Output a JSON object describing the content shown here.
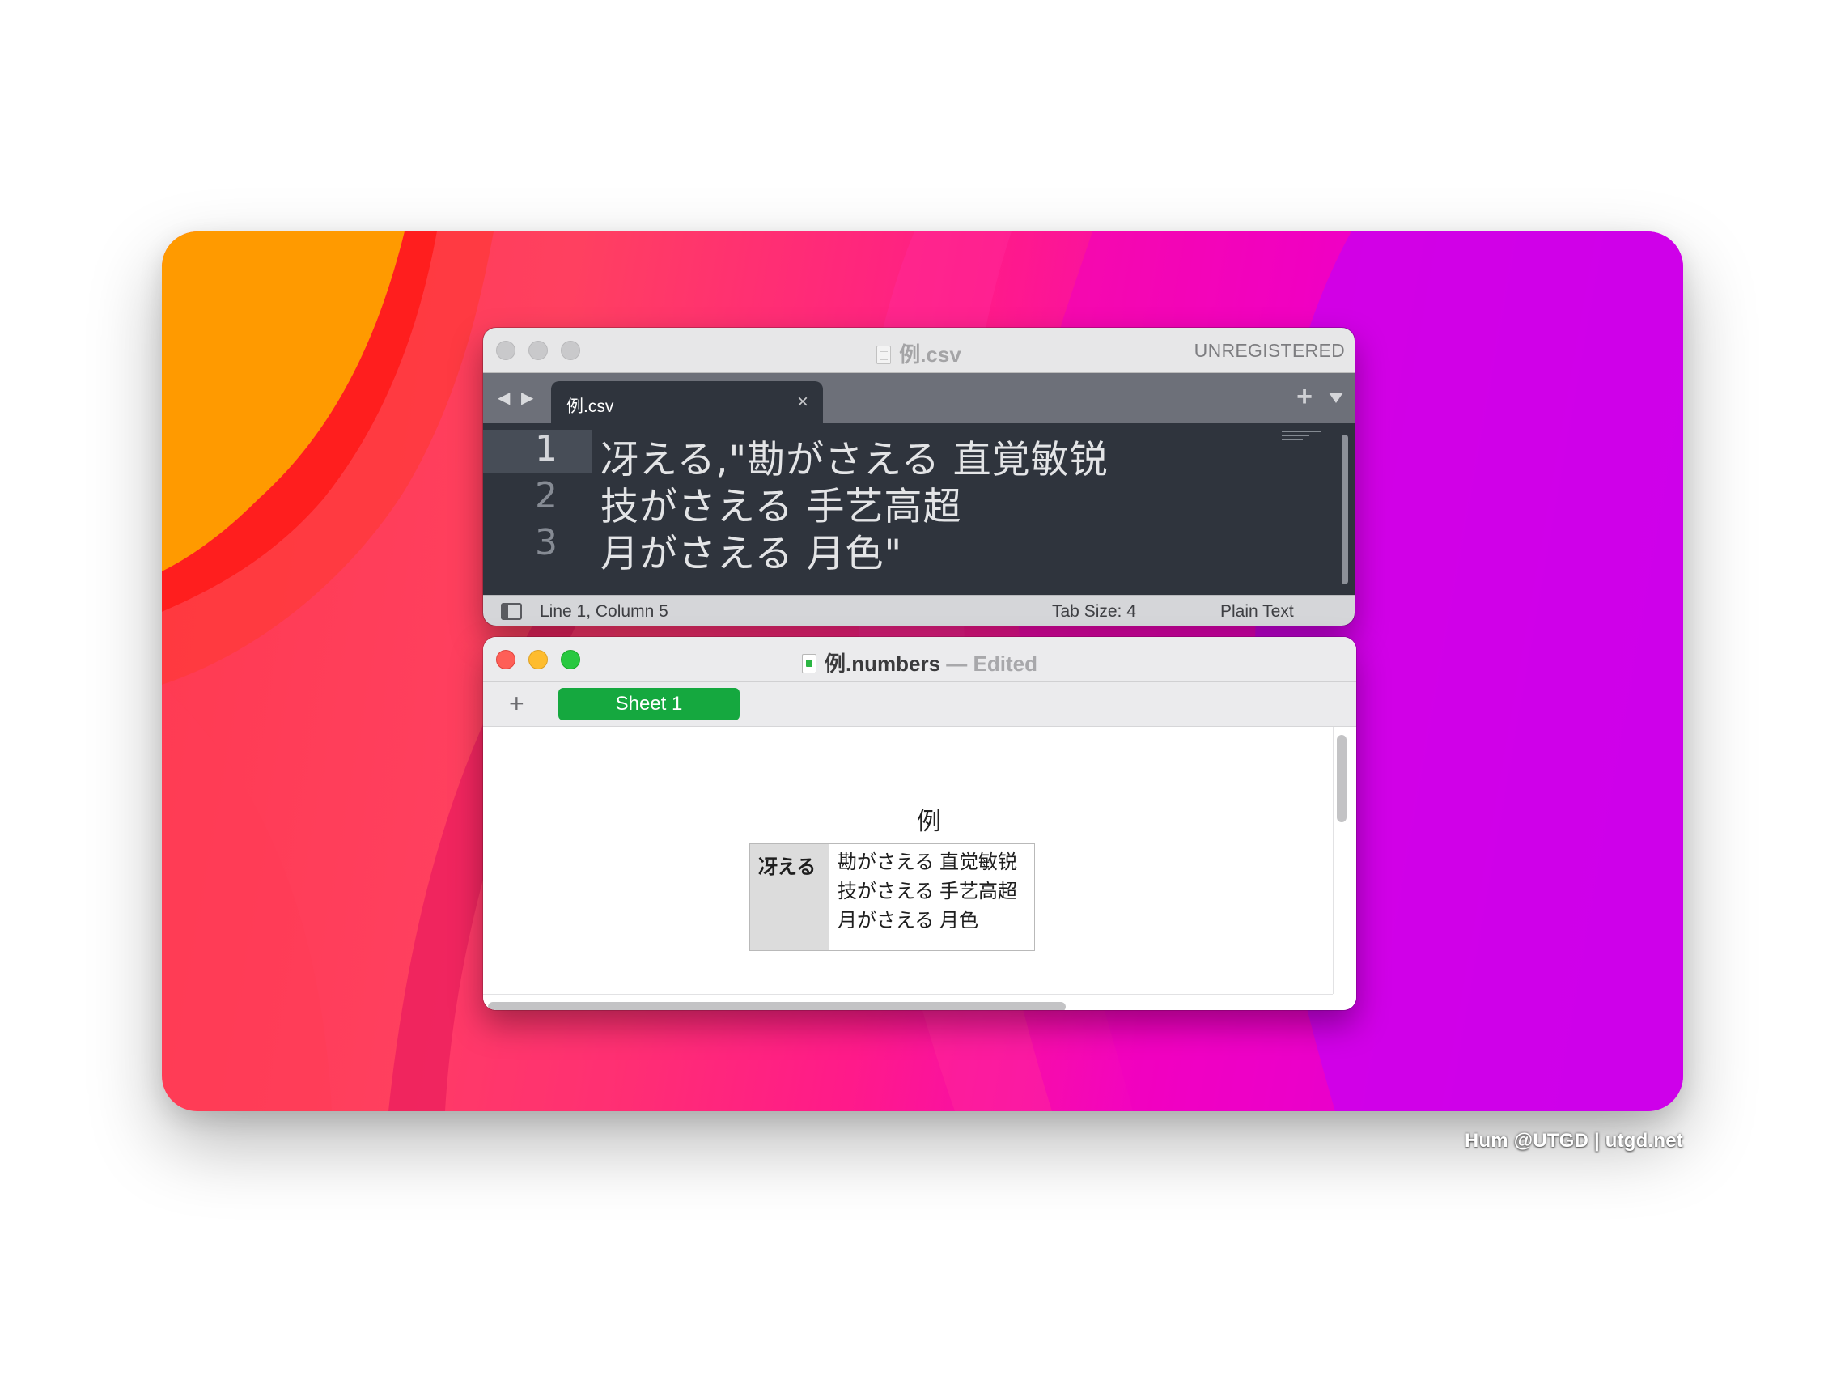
{
  "sublime": {
    "title": "例.csv",
    "unregistered": "UNREGISTERED",
    "nav_arrows": "◀ ▶",
    "tab_label": "例.csv",
    "tab_close": "×",
    "new_tab": "+",
    "lines": [
      {
        "num": "1",
        "text": "冴える,\"勘がさえる 直覚敏锐"
      },
      {
        "num": "2",
        "text": "技がさえる 手艺高超"
      },
      {
        "num": "3",
        "text": "月がさえる 月色\""
      }
    ],
    "status": {
      "position": "Line 1, Column 5",
      "tab_size": "Tab Size: 4",
      "syntax": "Plain Text"
    }
  },
  "numbers": {
    "title": "例.numbers",
    "separator": "—",
    "edited": "Edited",
    "add_sheet": "+",
    "sheet_tab": "Sheet 1",
    "table_title": "例",
    "header_cell": "冴える",
    "body_lines": [
      "勘がさえる 直觉敏锐",
      "技がさえる 手艺高超",
      "月がさえる 月色"
    ]
  },
  "watermark": "Hum @UTGD | utgd.net",
  "colors": {
    "sheet_tab": "#15a83f",
    "editor_bg": "#2f343d",
    "close": "#fe5f57",
    "minimize": "#febc2e",
    "zoom": "#28c840"
  }
}
